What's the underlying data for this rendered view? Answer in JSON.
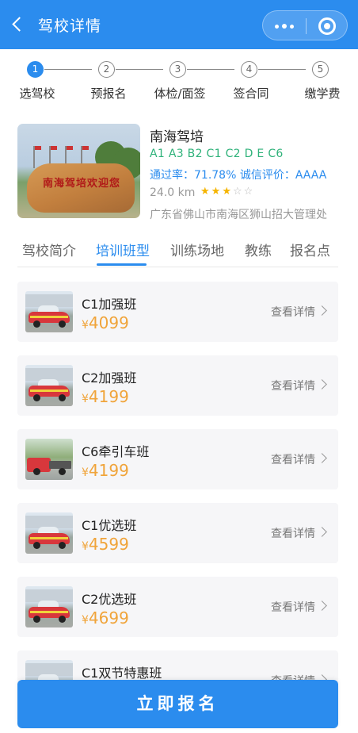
{
  "header": {
    "title": "驾校详情"
  },
  "steps": [
    {
      "num": "1",
      "label": "选驾校",
      "active": true
    },
    {
      "num": "2",
      "label": "预报名",
      "active": false
    },
    {
      "num": "3",
      "label": "体检/面签",
      "active": false
    },
    {
      "num": "4",
      "label": "签合同",
      "active": false
    },
    {
      "num": "5",
      "label": "缴学费",
      "active": false
    }
  ],
  "school": {
    "image_text": "南海驾培欢迎您",
    "name": "南海驾培",
    "licenses": "A1 A3 B2 C1 C2 D E C6",
    "rates": "通过率：71.78%  诚信评价：AAAA",
    "distance": "24.0 km",
    "rating": 3,
    "rating_max": 5,
    "address": "广东省佛山市南海区狮山招大管理处"
  },
  "tabs": [
    {
      "label": "驾校简介",
      "active": false
    },
    {
      "label": "培训班型",
      "active": true
    },
    {
      "label": "训练场地",
      "active": false
    },
    {
      "label": "教练",
      "active": false
    },
    {
      "label": "报名点",
      "active": false
    }
  ],
  "classes": [
    {
      "name": "C1加强班",
      "currency": "¥",
      "price": "4099",
      "detail": "查看详情",
      "image": "car"
    },
    {
      "name": "C2加强班",
      "currency": "¥",
      "price": "4199",
      "detail": "查看详情",
      "image": "car"
    },
    {
      "name": "C6牵引车班",
      "currency": "¥",
      "price": "4199",
      "detail": "查看详情",
      "image": "truck"
    },
    {
      "name": "C1优选班",
      "currency": "¥",
      "price": "4599",
      "detail": "查看详情",
      "image": "car"
    },
    {
      "name": "C2优选班",
      "currency": "¥",
      "price": "4699",
      "detail": "查看详情",
      "image": "car"
    },
    {
      "name": "C1双节特惠班",
      "currency": "",
      "price": "",
      "detail": "查看详情",
      "image": "car"
    }
  ],
  "signup_button": "立即报名",
  "colors": {
    "primary": "#2b8cee",
    "license_green": "#2fb27a",
    "price_orange": "#f0a43a",
    "star": "#f5b400"
  }
}
